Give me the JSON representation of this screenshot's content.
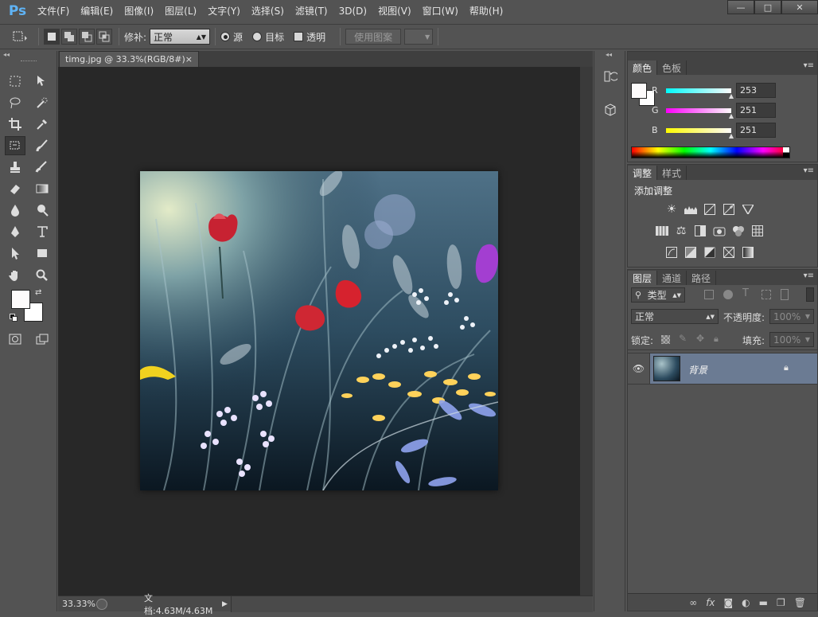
{
  "app": {
    "logo": "Ps"
  },
  "menu": [
    "文件(F)",
    "编辑(E)",
    "图像(I)",
    "图层(L)",
    "文字(Y)",
    "选择(S)",
    "滤镜(T)",
    "3D(D)",
    "视图(V)",
    "窗口(W)",
    "帮助(H)"
  ],
  "window_controls": {
    "minimize": "—",
    "maximize": "□",
    "close": "✕"
  },
  "options": {
    "patch_label": "修补:",
    "patch_mode": "正常",
    "source_label": "源",
    "target_label": "目标",
    "transparent_label": "透明",
    "use_pattern_label": "使用图案"
  },
  "document": {
    "tab_title": "timg.jpg @ 33.3%(RGB/8#)",
    "tab_close": "×"
  },
  "status": {
    "zoom": "33.33%",
    "doc_info": "文档:4.63M/4.63M"
  },
  "color_panel": {
    "tabs": [
      "颜色",
      "色板"
    ],
    "r_label": "R",
    "g_label": "G",
    "b_label": "B",
    "r": "253",
    "g": "251",
    "b": "251"
  },
  "adjust_panel": {
    "tabs": [
      "调整",
      "样式"
    ],
    "heading": "添加调整",
    "row1": [
      "brightness-icon",
      "levels-icon",
      "curves-icon",
      "exposure-icon",
      "vibrance-icon"
    ],
    "row2": [
      "hue-saturation-icon",
      "color-balance-icon",
      "black-white-icon",
      "photo-filter-icon",
      "channel-mixer-icon",
      "color-lookup-icon"
    ],
    "row3": [
      "invert-icon",
      "posterize-icon",
      "threshold-icon",
      "selective-color-icon",
      "gradient-map-icon"
    ]
  },
  "layers_panel": {
    "tabs": [
      "图层",
      "通道",
      "路径"
    ],
    "filter_kind": "类型",
    "blend_mode": "正常",
    "opacity_label": "不透明度:",
    "opacity": "100%",
    "lock_label": "锁定:",
    "fill_label": "填充:",
    "fill": "100%",
    "layer_name": "背景"
  },
  "colors": {
    "accent": "#5fb3f5",
    "selected_layer": "#6b7b93",
    "canvas": "#282828"
  }
}
